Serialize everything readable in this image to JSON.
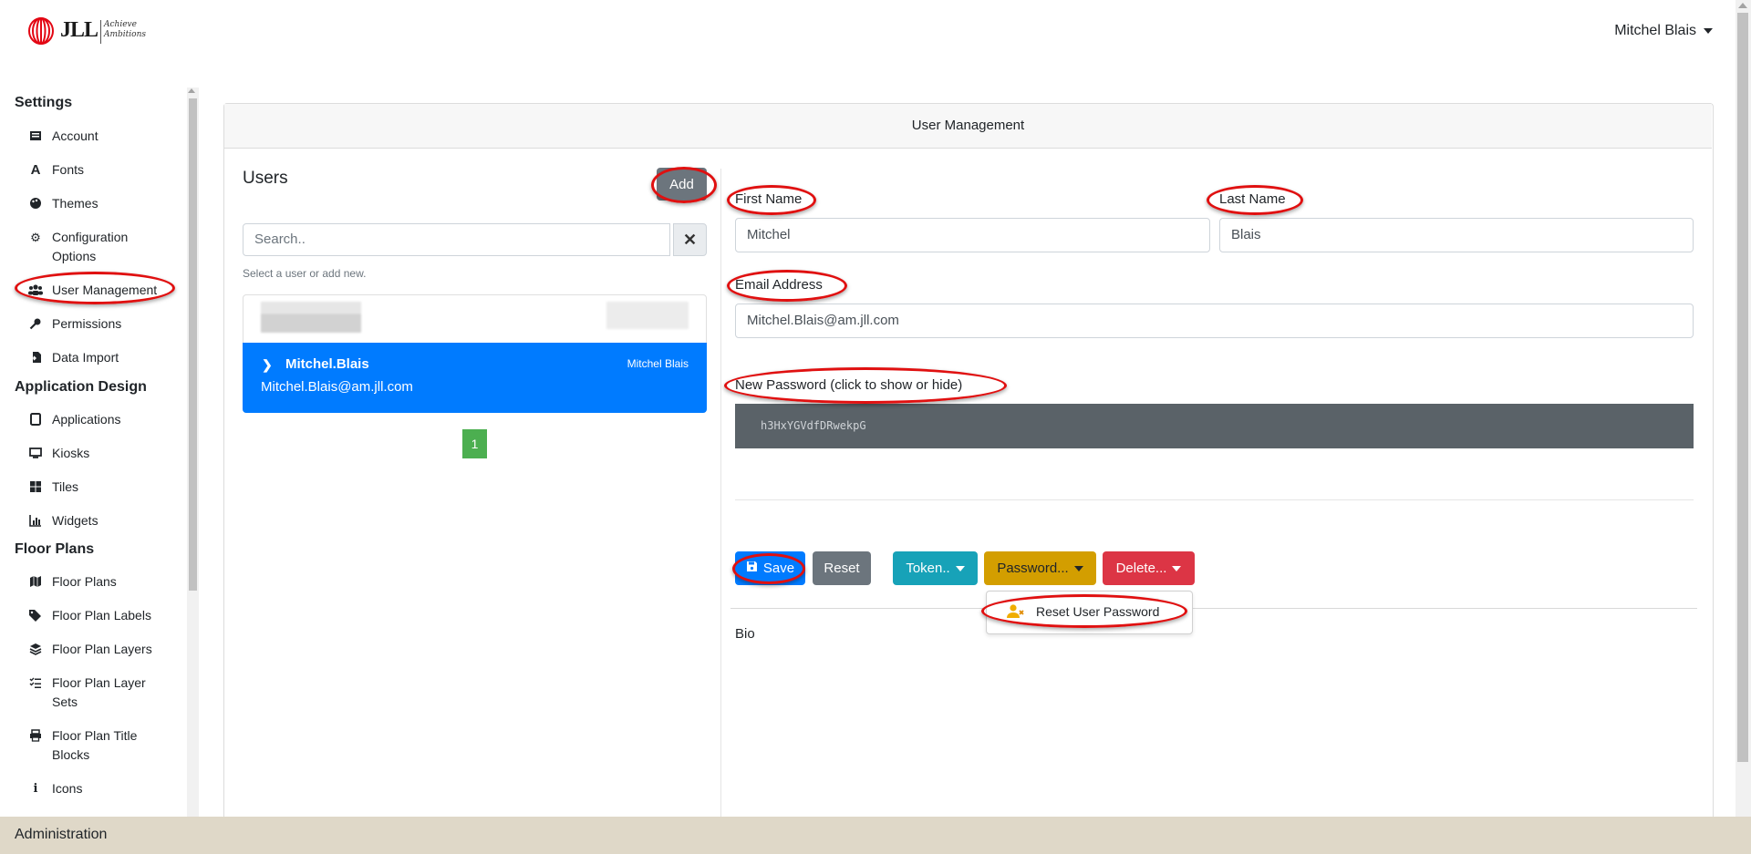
{
  "header": {
    "logo_text": "JLL",
    "logo_tagline_line1": "Achieve",
    "logo_tagline_line2": "Ambitions",
    "user_name": "Mitchel Blais"
  },
  "sidebar": {
    "sections": [
      {
        "title": "Settings"
      },
      {
        "title": "Application Design"
      },
      {
        "title": "Floor Plans"
      }
    ],
    "settings_items": [
      {
        "label": "Account",
        "icon": "list-icon"
      },
      {
        "label": "Fonts",
        "icon": "font-icon"
      },
      {
        "label": "Themes",
        "icon": "palette-icon"
      },
      {
        "label": "Configuration Options",
        "icon": "gear-icon"
      },
      {
        "label": "User Management",
        "icon": "users-icon"
      },
      {
        "label": "Permissions",
        "icon": "key-icon"
      },
      {
        "label": "Data Import",
        "icon": "file-import-icon"
      }
    ],
    "design_items": [
      {
        "label": "Applications",
        "icon": "tablet-icon"
      },
      {
        "label": "Kiosks",
        "icon": "monitor-icon"
      },
      {
        "label": "Tiles",
        "icon": "grid-icon"
      },
      {
        "label": "Widgets",
        "icon": "chart-icon"
      }
    ],
    "floor_items": [
      {
        "label": "Floor Plans",
        "icon": "map-icon"
      },
      {
        "label": "Floor Plan Labels",
        "icon": "tags-icon"
      },
      {
        "label": "Floor Plan Layers",
        "icon": "layers-icon"
      },
      {
        "label": "Floor Plan Layer Sets",
        "icon": "list-check-icon"
      },
      {
        "label": "Floor Plan Title Blocks",
        "icon": "print-icon"
      },
      {
        "label": "Icons",
        "icon": "info-icon"
      }
    ],
    "footer": "Administration"
  },
  "card": {
    "title": "User Management"
  },
  "users_panel": {
    "title": "Users",
    "add_label": "Add",
    "search_placeholder": "Search..",
    "hint": "Select a user or add new.",
    "selected_user": {
      "username": "Mitchel.Blais",
      "display_name": "Mitchel Blais",
      "email": "Mitchel.Blais@am.jll.com"
    },
    "pagination": [
      "1"
    ]
  },
  "form": {
    "first_name_label": "First Name",
    "first_name_value": "Mitchel",
    "last_name_label": "Last Name",
    "last_name_value": "Blais",
    "email_label": "Email Address",
    "email_value": "Mitchel.Blais@am.jll.com",
    "password_label": "New Password (click to show or hide)",
    "password_value": "h3HxYGVdfDRwekpG",
    "bio_label": "Bio"
  },
  "actions": {
    "save_label": "Save",
    "reset_label": "Reset",
    "token_label": "Token..",
    "password_label": "Password...",
    "delete_label": "Delete...",
    "password_menu_item": "Reset User Password"
  },
  "colors": {
    "primary": "#007bff",
    "secondary": "#6c757d",
    "info": "#17a2b8",
    "warning": "#d39e00",
    "danger": "#dc3545",
    "success": "#4caf50",
    "jll_red": "#e30613",
    "annotation_red": "#e01010",
    "footer_bg": "#dfd8c8"
  }
}
